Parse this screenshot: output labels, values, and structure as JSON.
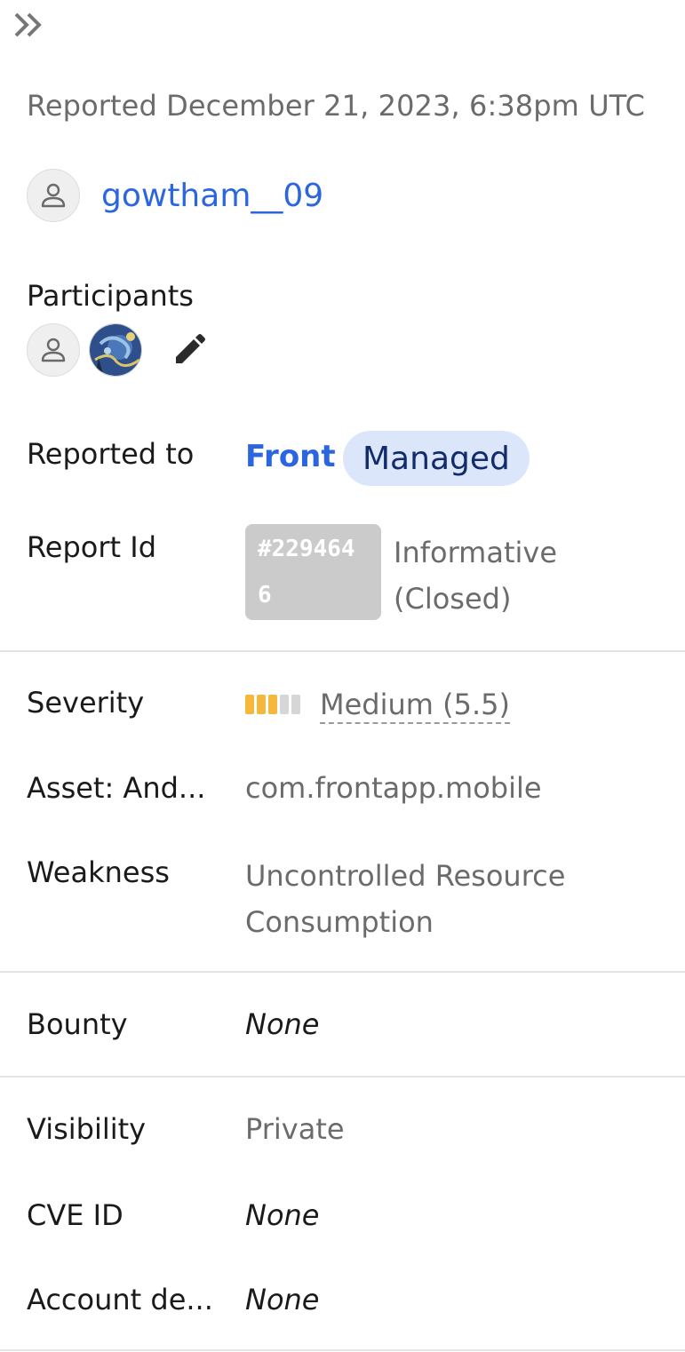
{
  "header": {
    "collapse_icon": "double-chevron-right-icon"
  },
  "reported_date": "Reported December 21, 2023, 6:38pm UTC",
  "reporter": {
    "name": "gowtham__09",
    "avatar_icon": "user-icon"
  },
  "participants": {
    "label": "Participants",
    "avatars": [
      "user-icon",
      "starry-night-photo"
    ],
    "edit_icon": "pencil-icon"
  },
  "details": {
    "reported_to": {
      "label": "Reported to",
      "program": "Front",
      "badge": "Managed"
    },
    "report_id": {
      "label": "Report Id",
      "id": "#2294646",
      "state": "Informative (Closed)"
    },
    "severity": {
      "label": "Severity",
      "value": "Medium (5.5)",
      "level_filled": 3,
      "level_total": 5
    },
    "asset": {
      "label": "Asset: And...",
      "value": "com.frontapp.mobile"
    },
    "weakness": {
      "label": "Weakness",
      "value": "Uncontrolled Resource Consumption"
    },
    "bounty": {
      "label": "Bounty",
      "value": "None"
    },
    "visibility": {
      "label": "Visibility",
      "value": "Private"
    },
    "cve_id": {
      "label": "CVE ID",
      "value": "None"
    },
    "account_details": {
      "label": "Account de...",
      "value": "None"
    }
  },
  "colors": {
    "link": "#2b66e0",
    "badge_bg": "#dce6fb",
    "badge_text": "#112b6b",
    "severity_filled": "#f5b83d",
    "severity_empty": "#d6d6d6",
    "id_box": "#cbcbcb"
  }
}
